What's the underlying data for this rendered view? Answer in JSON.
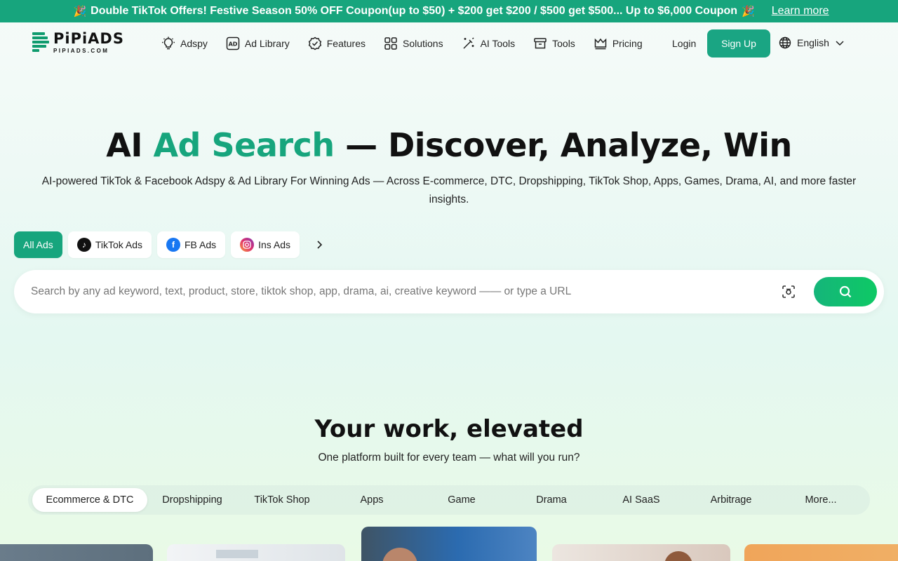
{
  "promo": {
    "text": "Double TikTok Offers! Festive Season 50% OFF Coupon(up to $50) + $200 get $200 / $500 get $500... Up to $6,000 Coupon",
    "learn_more": "Learn more",
    "color": "#17a57d"
  },
  "logo": {
    "name": "PiPiADS",
    "sub": "PIPIADS.COM"
  },
  "nav": {
    "items": [
      {
        "label": "Adspy",
        "icon": "lightbulb-icon"
      },
      {
        "label": "Ad Library",
        "icon": "ad-icon"
      },
      {
        "label": "Features",
        "icon": "badge-check-icon"
      },
      {
        "label": "Solutions",
        "icon": "grid-icon"
      },
      {
        "label": "AI Tools",
        "icon": "magic-wand-icon"
      },
      {
        "label": "Tools",
        "icon": "box-icon"
      },
      {
        "label": "Pricing",
        "icon": "crown-icon"
      }
    ],
    "login": "Login",
    "signup": "Sign Up",
    "language": "English"
  },
  "hero": {
    "title_pre": "AI ",
    "title_accent": "Ad Search",
    "title_post": " — Discover, Analyze, Win",
    "subtitle": "AI-powered TikTok & Facebook Adspy & Ad Library For Winning Ads — Across E-commerce, DTC, Dropshipping, TikTok Shop, Apps, Games, Drama, AI, and more faster insights."
  },
  "ad_tabs": [
    {
      "label": "All Ads",
      "active": true
    },
    {
      "label": "TikTok Ads",
      "icon": "tiktok-icon"
    },
    {
      "label": "FB Ads",
      "icon": "facebook-icon"
    },
    {
      "label": "Ins Ads",
      "icon": "instagram-icon"
    }
  ],
  "search": {
    "placeholder": "Search by any ad keyword, text, product, store, tiktok shop, app, drama, ai, creative keyword —— or type a URL",
    "value": ""
  },
  "section": {
    "title": "Your work, elevated",
    "subtitle": "One platform built for every team — what will you run?",
    "segments": [
      "Ecommerce & DTC",
      "Dropshipping",
      "TikTok Shop",
      "Apps",
      "Game",
      "Drama",
      "AI SaaS",
      "Arbitrage",
      "More..."
    ],
    "active_segment": "Ecommerce & DTC"
  },
  "colors": {
    "accent": "#17a57d",
    "search_button": "#0ec965"
  }
}
